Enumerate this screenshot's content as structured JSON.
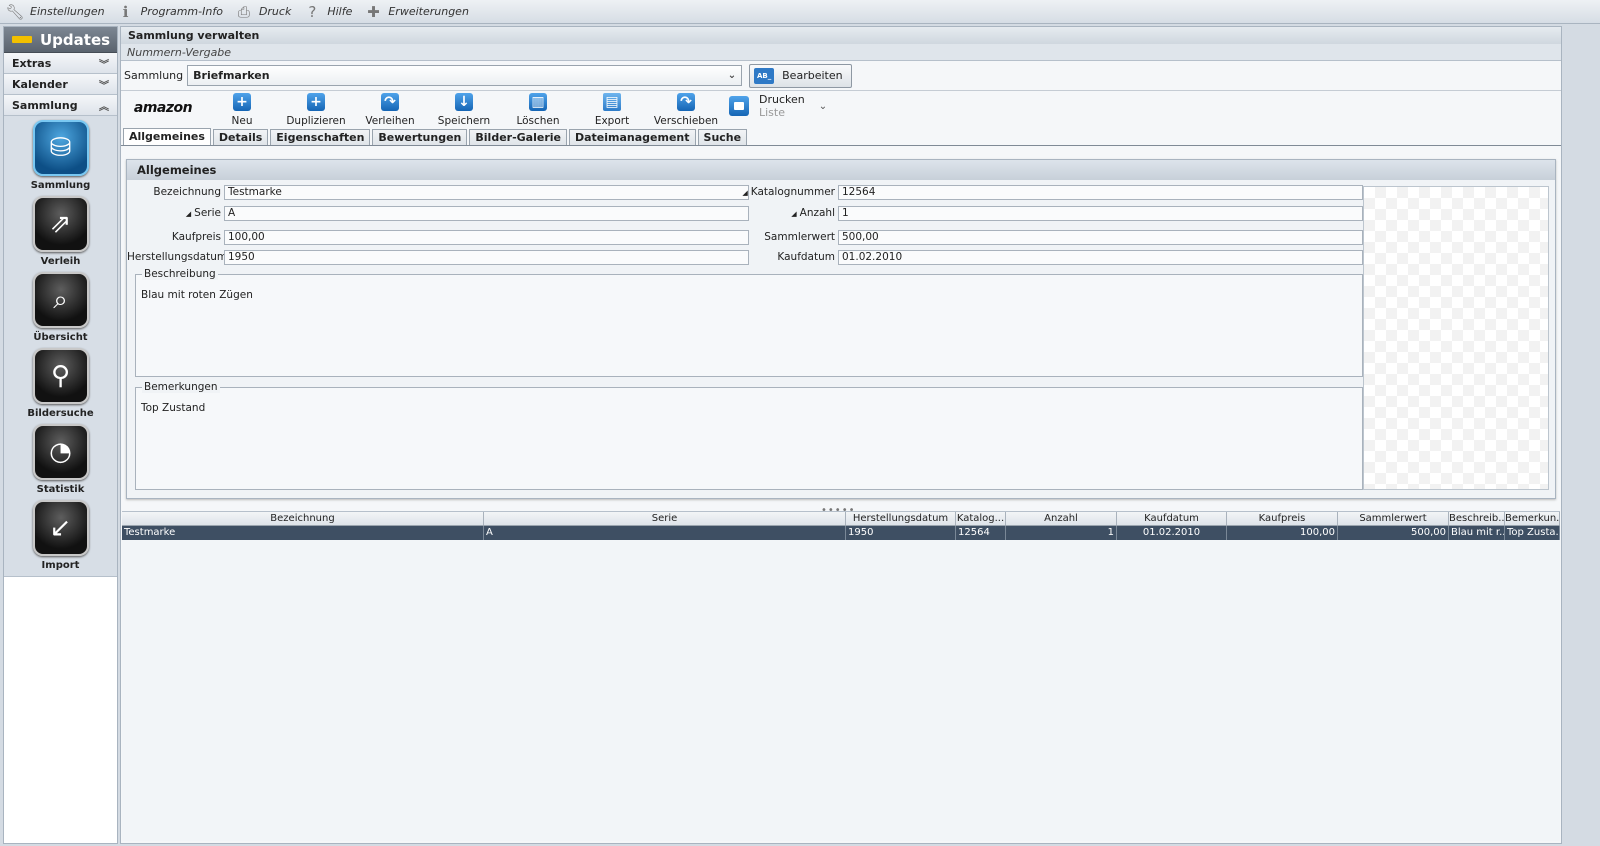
{
  "menu": {
    "einstellungen": "Einstellungen",
    "programm_info": "Programm-Info",
    "druck": "Druck",
    "hilfe": "Hilfe",
    "erweiterungen": "Erweiterungen"
  },
  "sidebar": {
    "updates": "Updates",
    "accordion": [
      "Extras",
      "Kalender",
      "Sammlung"
    ],
    "buttons": [
      "Sammlung",
      "Verleih",
      "Übersicht",
      "Bildersuche",
      "Statistik",
      "Import"
    ]
  },
  "header": {
    "title": "Sammlung verwalten",
    "subtitle": "Nummern-Vergabe"
  },
  "collection": {
    "label": "Sammlung",
    "value": "Briefmarken",
    "edit_label": "Bearbeiten",
    "edit_icon_text": "AB_"
  },
  "toolbar": {
    "amazon": "amazon",
    "neu": "Neu",
    "duplizieren": "Duplizieren",
    "verleihen": "Verleihen",
    "speichern": "Speichern",
    "loeschen": "Löschen",
    "export": "Export",
    "verschieben": "Verschieben",
    "drucken": "Drucken",
    "drucken_sub": "Liste"
  },
  "tabs": [
    "Allgemeines",
    "Details",
    "Eigenschaften",
    "Bewertungen",
    "Bilder-Galerie",
    "Dateimanagement",
    "Suche"
  ],
  "form": {
    "section": "Allgemeines",
    "bezeichnung_label": "Bezeichnung",
    "bezeichnung": "Testmarke",
    "serie_label": "Serie",
    "serie": "A",
    "kaufpreis_label": "Kaufpreis",
    "kaufpreis": "100,00",
    "herstellungsdatum_label": "Herstellungsdatum",
    "herstellungsdatum": "1950",
    "katalognummer_label": "Katalognummer",
    "katalognummer": "12564",
    "anzahl_label": "Anzahl",
    "anzahl": "1",
    "sammlerwert_label": "Sammlerwert",
    "sammlerwert": "500,00",
    "kaufdatum_label": "Kaufdatum",
    "kaufdatum": "01.02.2010",
    "beschreibung_label": "Beschreibung",
    "beschreibung": "Blau mit roten Zügen",
    "bemerkungen_label": "Bemerkungen",
    "bemerkungen": "Top Zustand"
  },
  "table": {
    "columns": [
      "Bezeichnung",
      "Serie",
      "Herstellungsdatum",
      "Katalog...",
      "Anzahl",
      "Kaufdatum",
      "Kaufpreis",
      "Sammlerwert",
      "Beschreib...",
      "Bemerkun..."
    ],
    "rows": [
      [
        "Testmarke",
        "A",
        "1950",
        "12564",
        "1",
        "01.02.2010",
        "100,00",
        "500,00",
        "Blau mit r...",
        "Top Zusta..."
      ]
    ]
  }
}
